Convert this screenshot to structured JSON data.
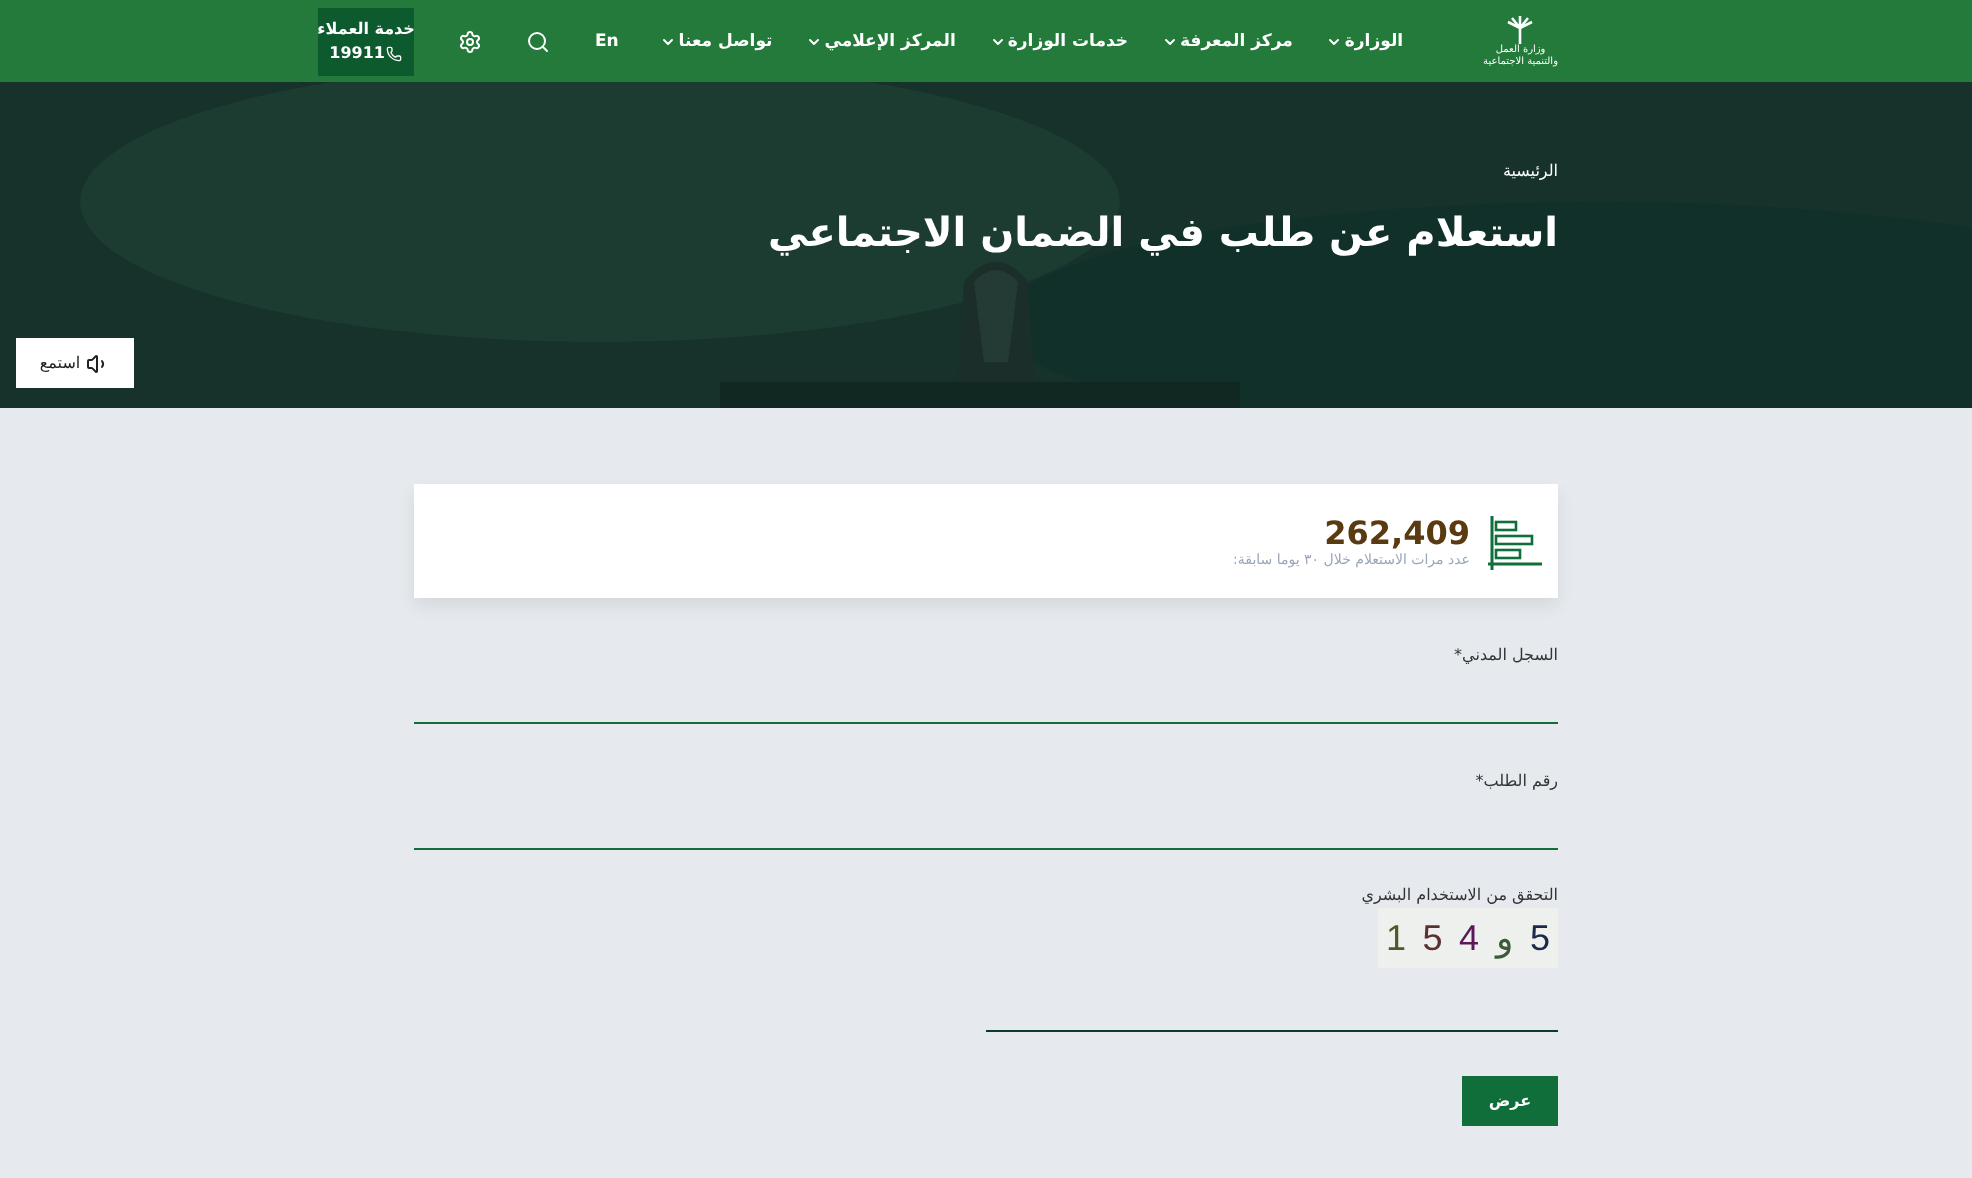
{
  "header": {
    "logo": {
      "line_1": "وزارة العمل",
      "line_2": "والتنمية الاجتماعية"
    },
    "menu": [
      {
        "label": "الوزارة",
        "dropdown": true
      },
      {
        "label": "مركز المعرفة",
        "dropdown": true
      },
      {
        "label": "خدمات الوزارة",
        "dropdown": true
      },
      {
        "label": "المركز الإعلامي",
        "dropdown": true
      },
      {
        "label": "تواصل معنا",
        "dropdown": true
      }
    ],
    "language": "En",
    "customer_service": {
      "label": "خدمة العملاء",
      "phone": "19911"
    }
  },
  "hero": {
    "breadcrumb": "الرئيسية",
    "title": "استعلام عن طلب في الضمان الاجتماعي",
    "listen_button": "استمع"
  },
  "stats": {
    "value": "262,409",
    "caption": "عدد مرات الاستعلام خلال ٣٠ يوما سابقة:"
  },
  "form": {
    "fields": [
      {
        "label": "السجل المدني",
        "required_mark": "*"
      },
      {
        "label": "رقم الطلب",
        "required_mark": "*"
      }
    ],
    "captcha": {
      "label": "التحقق من الاستخدام البشري",
      "characters": [
        {
          "char": "5",
          "color": "#1a2a4a"
        },
        {
          "char": "و",
          "color": "#3a5a3a"
        },
        {
          "char": "4",
          "color": "#5a1a5a"
        },
        {
          "char": "5",
          "color": "#5a3030"
        },
        {
          "char": "1",
          "color": "#4a5a2a"
        }
      ]
    },
    "submit": "عرض"
  }
}
